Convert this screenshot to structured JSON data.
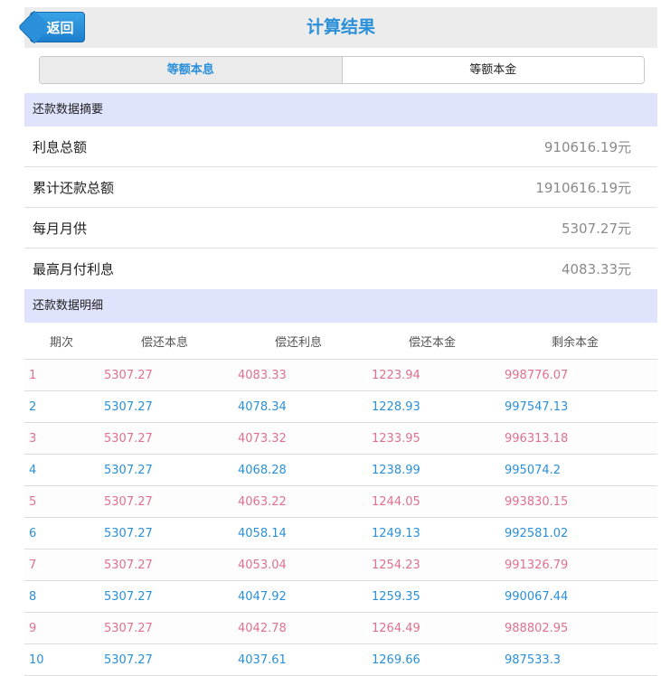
{
  "header": {
    "back_label": "返回",
    "title": "计算结果"
  },
  "tabs": [
    {
      "label": "等额本息",
      "active": true
    },
    {
      "label": "等额本金",
      "active": false
    }
  ],
  "summary": {
    "section_title": "还款数据摘要",
    "rows": [
      {
        "label": "利息总额",
        "value": "910616.19元"
      },
      {
        "label": "累计还款总额",
        "value": "1910616.19元"
      },
      {
        "label": "每月月供",
        "value": "5307.27元"
      },
      {
        "label": "最高月付利息",
        "value": "4083.33元"
      }
    ]
  },
  "detail": {
    "section_title": "还款数据明细",
    "columns": [
      "期次",
      "偿还本息",
      "偿还利息",
      "偿还本金",
      "剩余本金"
    ],
    "rows": [
      [
        "1",
        "5307.27",
        "4083.33",
        "1223.94",
        "998776.07"
      ],
      [
        "2",
        "5307.27",
        "4078.34",
        "1228.93",
        "997547.13"
      ],
      [
        "3",
        "5307.27",
        "4073.32",
        "1233.95",
        "996313.18"
      ],
      [
        "4",
        "5307.27",
        "4068.28",
        "1238.99",
        "995074.2"
      ],
      [
        "5",
        "5307.27",
        "4063.22",
        "1244.05",
        "993830.15"
      ],
      [
        "6",
        "5307.27",
        "4058.14",
        "1249.13",
        "992581.02"
      ],
      [
        "7",
        "5307.27",
        "4053.04",
        "1254.23",
        "991326.79"
      ],
      [
        "8",
        "5307.27",
        "4047.92",
        "1259.35",
        "990067.44"
      ],
      [
        "9",
        "5307.27",
        "4042.78",
        "1264.49",
        "988802.95"
      ],
      [
        "10",
        "5307.27",
        "4037.61",
        "1269.66",
        "987533.3"
      ]
    ]
  },
  "colors": {
    "accent": "#2a90d9",
    "odd_row": "#e0718e",
    "section_bg": "#dfe4fc"
  }
}
